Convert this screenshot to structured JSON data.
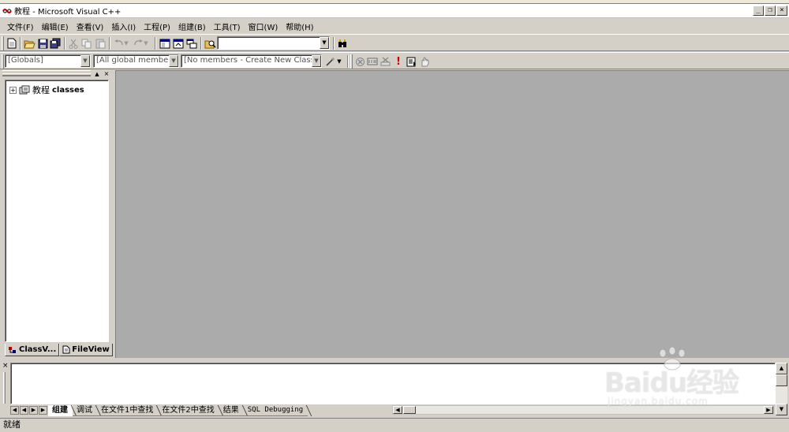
{
  "window": {
    "title": "教程 - Microsoft Visual C++",
    "min_glyph": "_",
    "restore_glyph": "❐",
    "close_glyph": "×"
  },
  "menu": [
    "文件(F)",
    "编辑(E)",
    "查看(V)",
    "插入(I)",
    "工程(P)",
    "组建(B)",
    "工具(T)",
    "窗口(W)",
    "帮助(H)"
  ],
  "toolbar": {
    "find_combo_value": "",
    "icons": [
      "new-icon",
      "open-icon",
      "save-icon",
      "save-all-icon",
      "cut-icon",
      "copy-icon",
      "paste-icon",
      "undo-icon",
      "redo-icon",
      "workspace-icon",
      "output-icon",
      "window-list-icon",
      "find-in-files-icon",
      "search-icon"
    ]
  },
  "wizardbar": {
    "class_combo": "[Globals]",
    "filter_combo": "[All global members",
    "members_combo": "[No members - Create New Class...]",
    "icons": [
      "wizard-action-icon",
      "compile-icon",
      "build-icon",
      "stop-build-icon",
      "execute-icon",
      "go-icon",
      "breakpoint-icon"
    ]
  },
  "workspace": {
    "tree_root_cn": "教程",
    "tree_root_en": "classes",
    "expand_glyph": "+",
    "tabs": [
      {
        "label": "ClassV...",
        "active": false
      },
      {
        "label": "FileView",
        "active": true
      }
    ]
  },
  "output": {
    "tabs": [
      {
        "label": "组建",
        "active": true
      },
      {
        "label": "调试",
        "active": false
      },
      {
        "label": "在文件1中查找",
        "active": false
      },
      {
        "label": "在文件2中查找",
        "active": false
      },
      {
        "label": "结果",
        "active": false
      },
      {
        "label": "SQL Debugging",
        "active": false
      }
    ]
  },
  "status": {
    "text": "就绪"
  },
  "watermark": {
    "logo": "Baidu经验",
    "url": "jingyan.baidu.com"
  },
  "colors": {
    "chrome": "#d4d0c8",
    "mdi_background": "#ababab"
  }
}
